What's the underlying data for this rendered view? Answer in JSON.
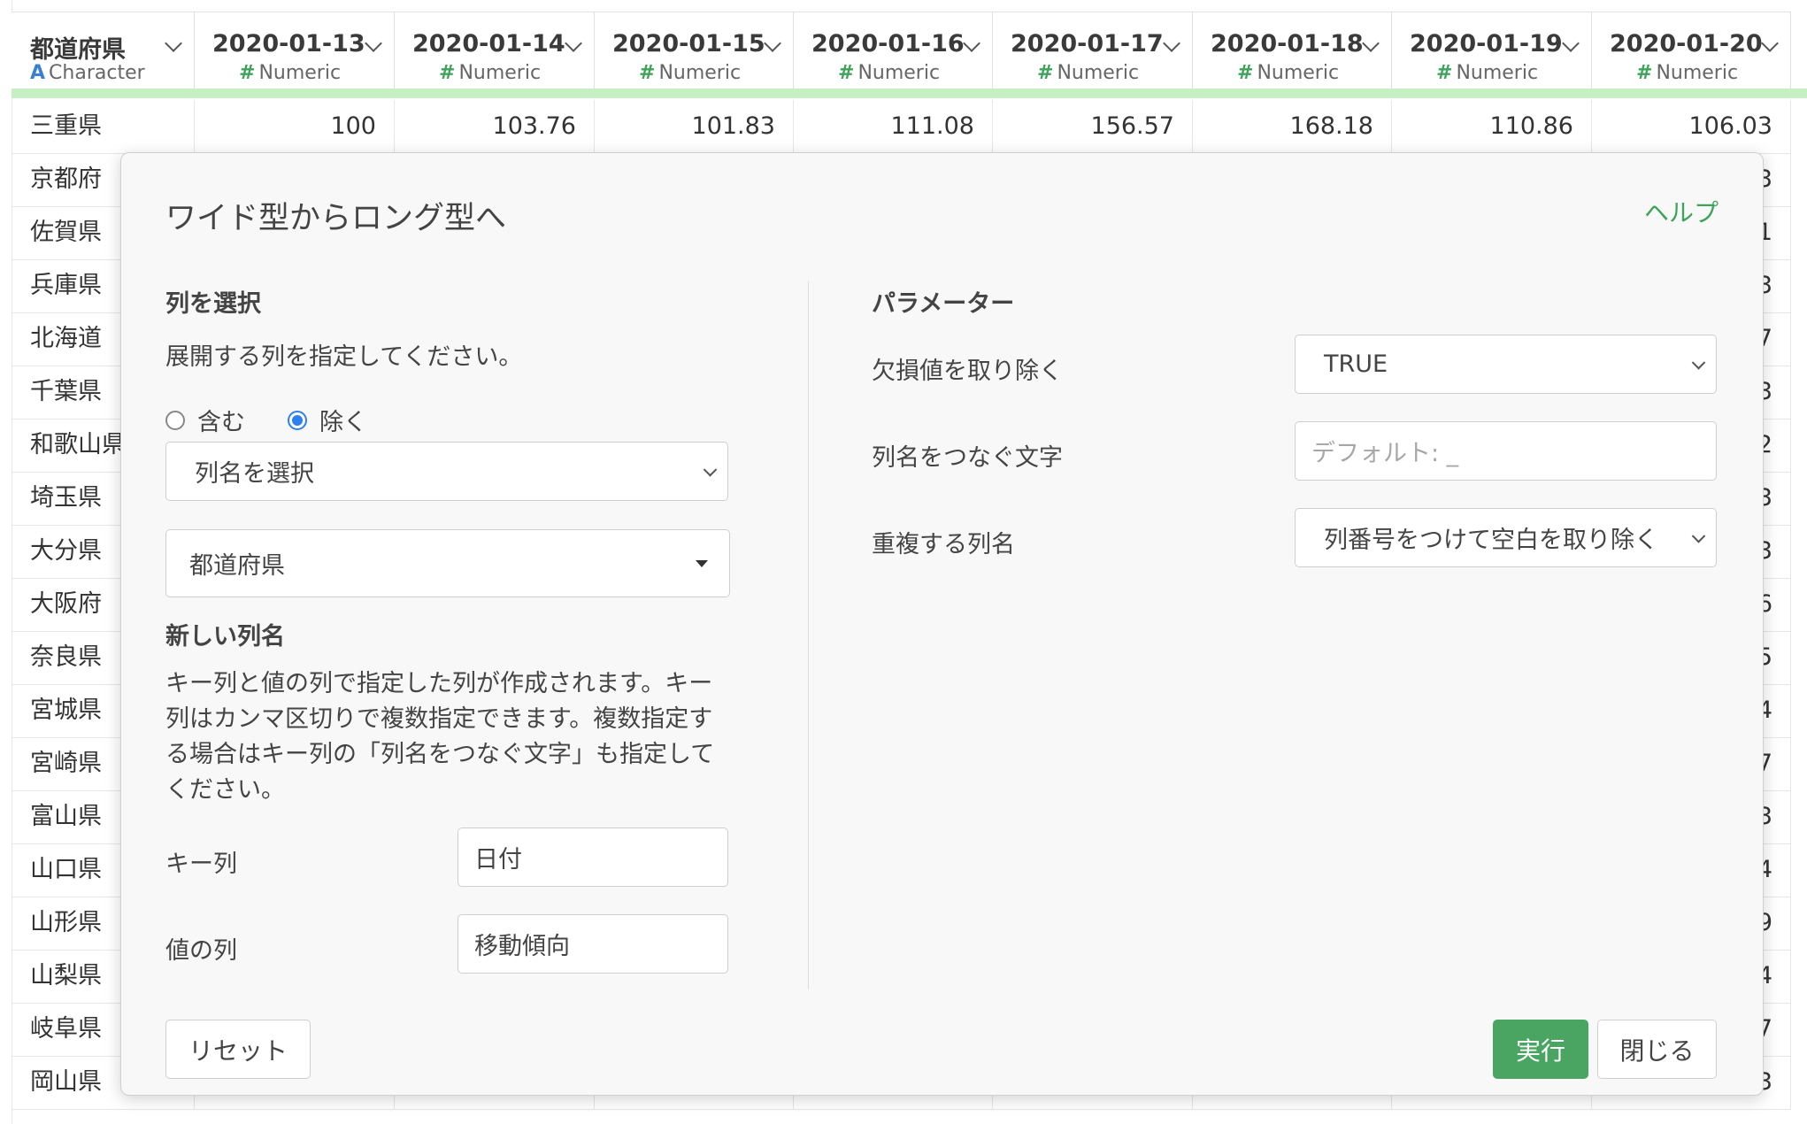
{
  "table": {
    "columns": [
      {
        "name": "都道府県",
        "type": "Character",
        "type_icon": "A"
      },
      {
        "name": "2020-01-13",
        "type": "Numeric",
        "type_icon": "#"
      },
      {
        "name": "2020-01-14",
        "type": "Numeric",
        "type_icon": "#"
      },
      {
        "name": "2020-01-15",
        "type": "Numeric",
        "type_icon": "#"
      },
      {
        "name": "2020-01-16",
        "type": "Numeric",
        "type_icon": "#"
      },
      {
        "name": "2020-01-17",
        "type": "Numeric",
        "type_icon": "#"
      },
      {
        "name": "2020-01-18",
        "type": "Numeric",
        "type_icon": "#"
      },
      {
        "name": "2020-01-19",
        "type": "Numeric",
        "type_icon": "#"
      },
      {
        "name": "2020-01-20",
        "type": "Numeric",
        "type_icon": "#"
      }
    ],
    "rows": [
      {
        "pref": "三重県",
        "values": [
          "100",
          "103.76",
          "101.83",
          "111.08",
          "156.57",
          "168.18",
          "110.86",
          "106.03"
        ]
      },
      {
        "pref": "京都府",
        "last": "3"
      },
      {
        "pref": "佐賀県",
        "last": "1"
      },
      {
        "pref": "兵庫県",
        "last": "3"
      },
      {
        "pref": "北海道",
        "last": "7"
      },
      {
        "pref": "千葉県",
        "last": "3"
      },
      {
        "pref": "和歌山県",
        "last": "2"
      },
      {
        "pref": "埼玉県",
        "last": "3"
      },
      {
        "pref": "大分県",
        "last": "3"
      },
      {
        "pref": "大阪府",
        "last": "6"
      },
      {
        "pref": "奈良県",
        "last": "5"
      },
      {
        "pref": "宮城県",
        "last": "4"
      },
      {
        "pref": "宮崎県",
        "last": "7"
      },
      {
        "pref": "富山県",
        "last": "3"
      },
      {
        "pref": "山口県",
        "last": "4"
      },
      {
        "pref": "山形県",
        "last": "9"
      },
      {
        "pref": "山梨県",
        "last": "4"
      },
      {
        "pref": "岐阜県",
        "last": "7"
      },
      {
        "pref": "岡山県",
        "last": "3"
      }
    ]
  },
  "colors": {
    "accent_green": "#4aa562",
    "header_stripe": "#c6efc3",
    "radio_blue": "#2f7ff0",
    "character_icon": "#3b7fd1"
  },
  "dialog": {
    "title": "ワイド型からロング型へ",
    "help_label": "ヘルプ",
    "select_columns": {
      "heading": "列を選択",
      "description": "展開する列を指定してください。",
      "radio_include": "含む",
      "radio_exclude": "除く",
      "selected_mode": "exclude",
      "column_select_placeholder": "列名を選択",
      "selected_column": "都道府県"
    },
    "new_columns": {
      "heading": "新しい列名",
      "description": "キー列と値の列で指定した列が作成されます。キー列はカンマ区切りで複数指定できます。複数指定する場合はキー列の「列名をつなぐ文字」も指定してください。",
      "key_label": "キー列",
      "key_value": "日付",
      "value_label": "値の列",
      "value_value": "移動傾向"
    },
    "parameters": {
      "heading": "パラメーター",
      "remove_na_label": "欠損値を取り除く",
      "remove_na_value": "TRUE",
      "separator_label": "列名をつなぐ文字",
      "separator_placeholder": "デフォルト: _",
      "duplicate_label": "重複する列名",
      "duplicate_value": "列番号をつけて空白を取り除く"
    },
    "buttons": {
      "reset": "リセット",
      "run": "実行",
      "close": "閉じる"
    }
  }
}
